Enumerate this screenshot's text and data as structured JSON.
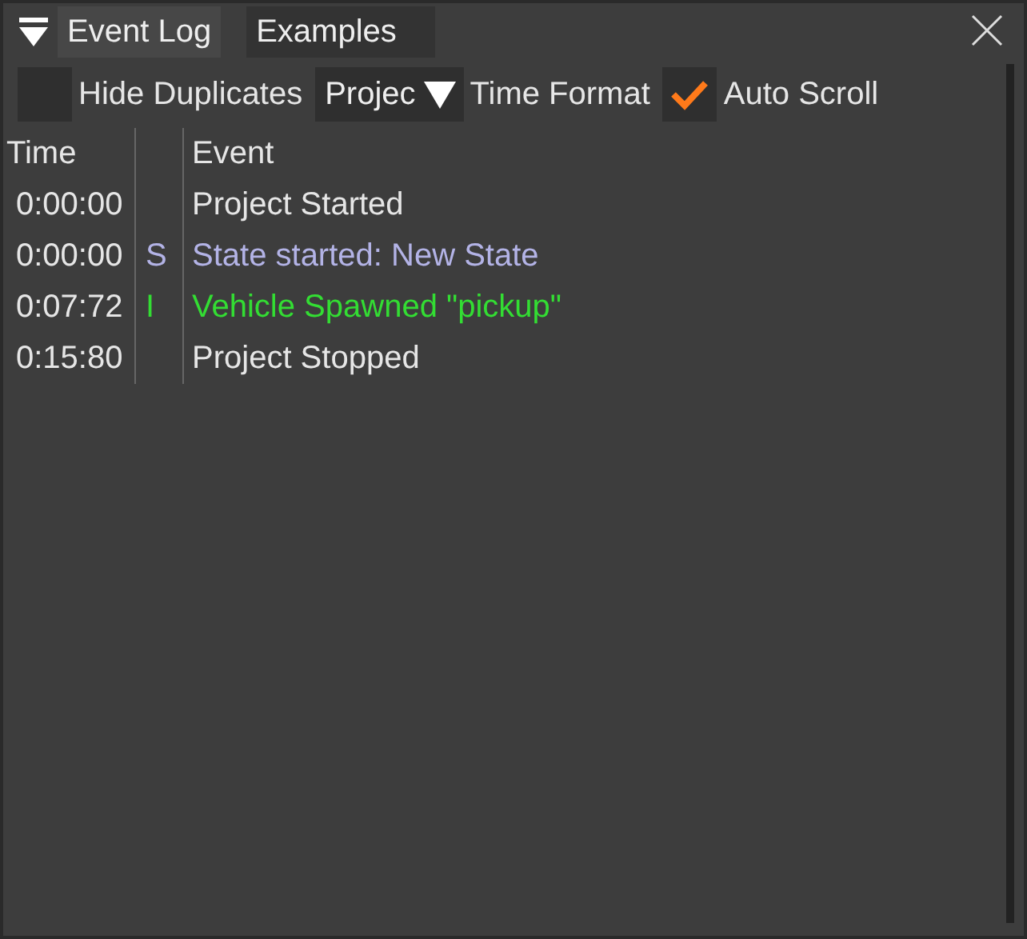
{
  "tabs": [
    {
      "label": "Event Log",
      "selected": true
    },
    {
      "label": "Examples",
      "selected": false
    }
  ],
  "toolbar": {
    "hide_duplicates": {
      "label": "Hide Duplicates",
      "checked": false
    },
    "filter_dropdown": {
      "value": "Projec"
    },
    "time_format": {
      "label": "Time Format"
    },
    "auto_scroll": {
      "label": "Auto Scroll",
      "checked": true
    }
  },
  "table": {
    "columns": [
      "Time",
      "",
      "Event"
    ],
    "rows": [
      {
        "time": "0:00:00",
        "type": "",
        "event": "Project Started",
        "color": "#e6e6e6"
      },
      {
        "time": "0:00:00",
        "type": "S",
        "event": "State started: New State",
        "color": "#b3b3e6"
      },
      {
        "time": "0:07:72",
        "type": "I",
        "event": "Vehicle Spawned \"pickup\"",
        "color": "#33dd33"
      },
      {
        "time": "0:15:80",
        "type": "",
        "event": "Project Stopped",
        "color": "#e6e6e6"
      }
    ]
  }
}
